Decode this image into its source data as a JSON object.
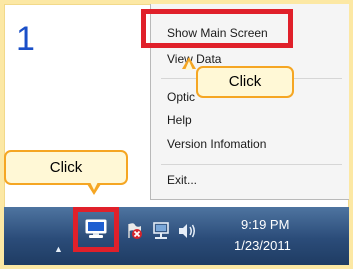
{
  "step": {
    "number": "1"
  },
  "context_menu": {
    "items": [
      {
        "label": "Show Main Screen"
      },
      {
        "label": "View Data"
      },
      {
        "label": "Optic"
      },
      {
        "label": "Help"
      },
      {
        "label": "Version Infomation"
      },
      {
        "label": "Exit..."
      }
    ]
  },
  "callouts": {
    "menu_click": "Click",
    "tray_click": "Click"
  },
  "taskbar": {
    "clock_time": "9:19 PM",
    "clock_date": "1/23/2011",
    "icons": [
      "show-hidden-icons-arrow",
      "app-tray-icon",
      "flag-icon",
      "network-icon",
      "volume-icon"
    ]
  },
  "colors": {
    "background": "#fce8a4",
    "highlight": "#e0202a",
    "callout_border": "#f5a623",
    "callout_fill": "#fff8d6",
    "step_number": "#1a4fc8",
    "taskbar": "#2b4c79"
  }
}
